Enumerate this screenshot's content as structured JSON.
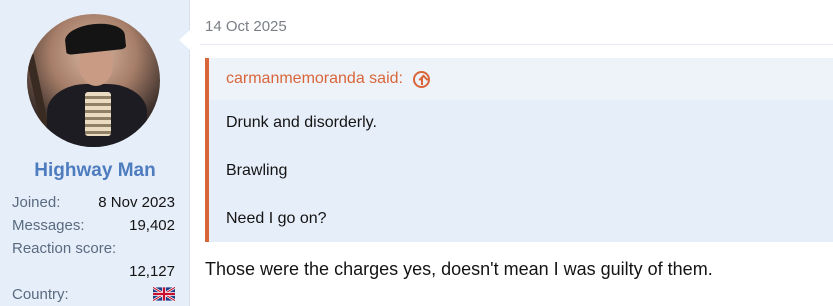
{
  "post": {
    "date": "14 Oct 2025"
  },
  "user": {
    "name": "Highway Man",
    "stats": [
      {
        "label": "Joined:",
        "value": "8 Nov 2023"
      },
      {
        "label": "Messages:",
        "value": "19,402"
      },
      {
        "label": "Reaction score:",
        "value": "12,127"
      },
      {
        "label": "Country:",
        "value": "uk-flag-icon"
      }
    ]
  },
  "quote": {
    "author_line": "carmanmemoranda said:",
    "lines": [
      "Drunk and disorderly.",
      "Brawling",
      "Need I go on?"
    ]
  },
  "reply": {
    "text": "Those were the charges yes, doesn't mean I was guilty of them."
  },
  "colors": {
    "user_pane_bg": "#e6eef9",
    "username": "#4d7cbf",
    "quote_accent": "#d9663a",
    "quote_bg": "#e6eef9"
  }
}
